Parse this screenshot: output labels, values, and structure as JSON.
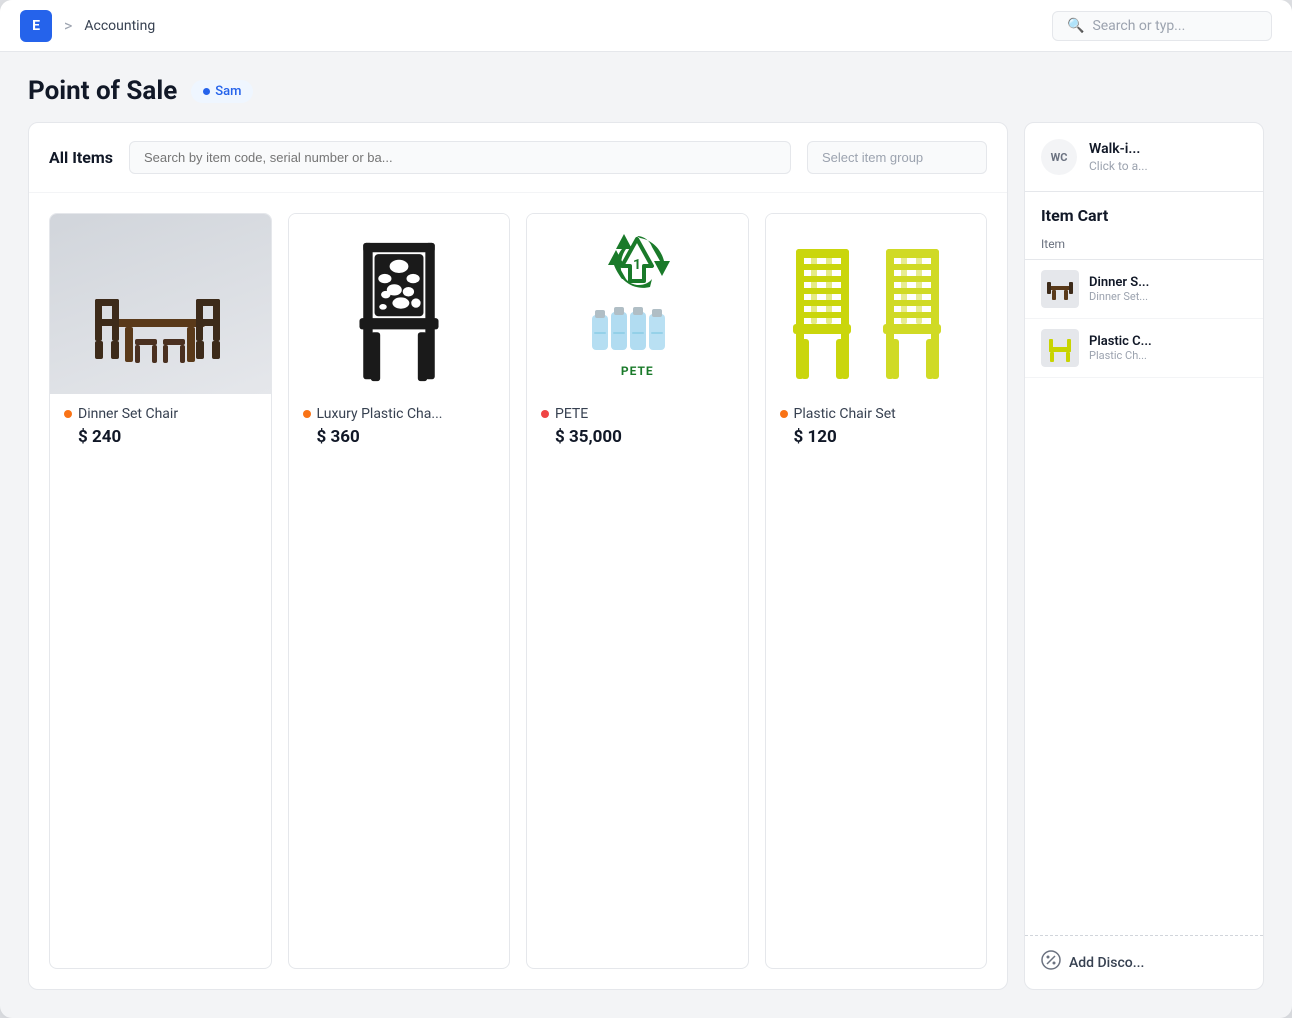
{
  "app": {
    "icon_label": "E",
    "breadcrumb_sep": ">",
    "breadcrumb": "Accounting",
    "search_placeholder": "Search or typ..."
  },
  "page": {
    "title": "Point of Sale",
    "user_badge": "Sam"
  },
  "items_panel": {
    "title": "All Items",
    "search_placeholder": "Search by item code, serial number or ba...",
    "group_placeholder": "Select item group",
    "items": [
      {
        "id": "dinner-set-chair",
        "name": "Dinner Set Chair",
        "price": "$ 240",
        "dot_color": "#f97316",
        "image_type": "dinner-set"
      },
      {
        "id": "luxury-plastic-chair",
        "name": "Luxury Plastic Cha...",
        "price": "$ 360",
        "dot_color": "#f97316",
        "image_type": "luxury-chair"
      },
      {
        "id": "pete",
        "name": "PETE",
        "price": "$ 35,000",
        "dot_color": "#ef4444",
        "image_type": "pete"
      },
      {
        "id": "plastic-chair-set",
        "name": "Plastic Chair Set",
        "price": "$ 120",
        "dot_color": "#f97316",
        "image_type": "plastic-chair-set"
      }
    ]
  },
  "right_panel": {
    "walk_in": {
      "badge": "WC",
      "title": "Walk-i...",
      "subtitle": "Click to a..."
    },
    "item_cart": {
      "title": "Item Cart",
      "col_header": "Item",
      "cart_items": [
        {
          "id": "cart-dinner-set",
          "name": "Dinner S...",
          "sub": "Dinner Set...",
          "image_type": "dinner-set-thumb"
        },
        {
          "id": "cart-plastic-chair",
          "name": "Plastic C...",
          "sub": "Plastic Ch...",
          "image_type": "plastic-chair-thumb"
        }
      ]
    },
    "add_discount": {
      "label": "Add Disco..."
    }
  }
}
